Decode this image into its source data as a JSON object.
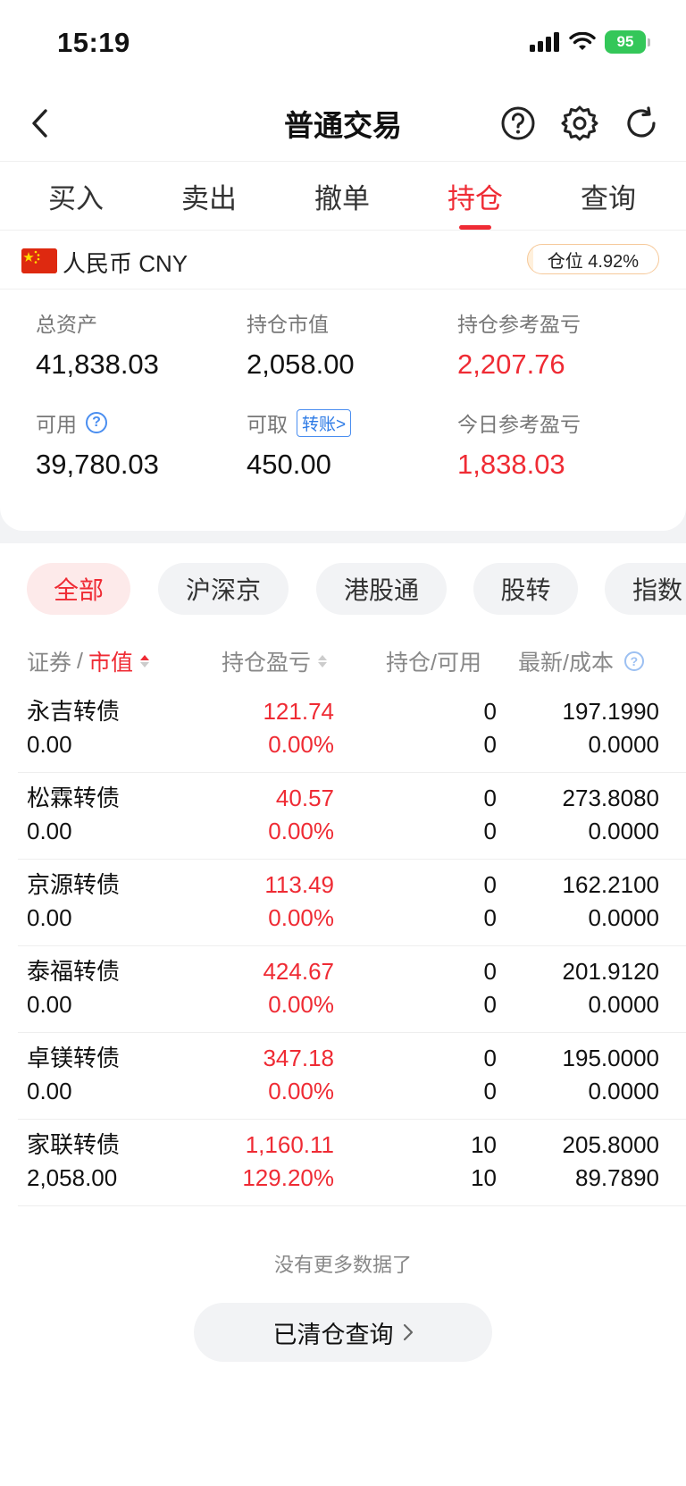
{
  "status_bar": {
    "time": "15:19",
    "battery": "95"
  },
  "nav": {
    "title": "普通交易"
  },
  "tabs": [
    {
      "label": "买入"
    },
    {
      "label": "卖出"
    },
    {
      "label": "撤单"
    },
    {
      "label": "持仓",
      "active": true
    },
    {
      "label": "查询"
    }
  ],
  "currency": {
    "label": "人民币 CNY",
    "position_ratio": "仓位 4.92%"
  },
  "summary": {
    "total_assets": {
      "label": "总资产",
      "value": "41,838.03"
    },
    "market_value": {
      "label": "持仓市值",
      "value": "2,058.00"
    },
    "position_pl": {
      "label": "持仓参考盈亏",
      "value": "2,207.76"
    },
    "available": {
      "label": "可用",
      "value": "39,780.03"
    },
    "withdrawable": {
      "label": "可取",
      "value": "450.00",
      "transfer_label": "转账>"
    },
    "today_pl": {
      "label": "今日参考盈亏",
      "value": "1,838.03"
    }
  },
  "filters": [
    {
      "label": "全部",
      "active": true
    },
    {
      "label": "沪深京"
    },
    {
      "label": "港股通"
    },
    {
      "label": "股转"
    },
    {
      "label": "指数"
    }
  ],
  "table": {
    "headers": {
      "security": "证券",
      "market_value": "市值",
      "pl": "持仓盈亏",
      "qty": "持仓/可用",
      "price": "最新/成本"
    },
    "rows": [
      {
        "name": "永吉转债",
        "market_value": "0.00",
        "pl": "121.74",
        "pl_pct": "0.00%",
        "qty": "0",
        "avail": "0",
        "latest": "197.1990",
        "cost": "0.0000"
      },
      {
        "name": "松霖转债",
        "market_value": "0.00",
        "pl": "40.57",
        "pl_pct": "0.00%",
        "qty": "0",
        "avail": "0",
        "latest": "273.8080",
        "cost": "0.0000"
      },
      {
        "name": "京源转债",
        "market_value": "0.00",
        "pl": "113.49",
        "pl_pct": "0.00%",
        "qty": "0",
        "avail": "0",
        "latest": "162.2100",
        "cost": "0.0000"
      },
      {
        "name": "泰福转债",
        "market_value": "0.00",
        "pl": "424.67",
        "pl_pct": "0.00%",
        "qty": "0",
        "avail": "0",
        "latest": "201.9120",
        "cost": "0.0000"
      },
      {
        "name": "卓镁转债",
        "market_value": "0.00",
        "pl": "347.18",
        "pl_pct": "0.00%",
        "qty": "0",
        "avail": "0",
        "latest": "195.0000",
        "cost": "0.0000"
      },
      {
        "name": "家联转债",
        "market_value": "2,058.00",
        "pl": "1,160.11",
        "pl_pct": "129.20%",
        "qty": "10",
        "avail": "10",
        "latest": "205.8000",
        "cost": "89.7890"
      }
    ]
  },
  "footer": {
    "no_more": "没有更多数据了",
    "cleared_button": "已清仓查询"
  },
  "colors": {
    "accent_red": "#ef2b34",
    "link_blue": "#2e7be6",
    "chip_bg": "#f2f3f5"
  }
}
